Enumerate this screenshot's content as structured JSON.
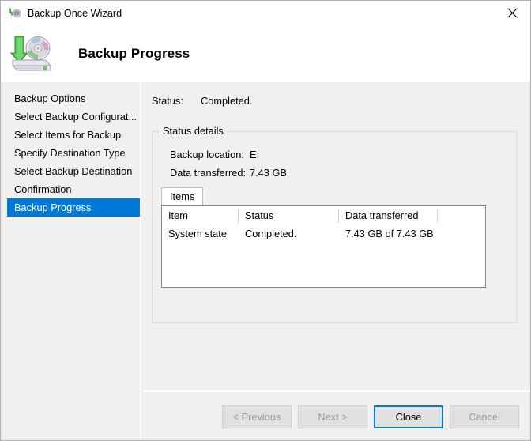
{
  "window": {
    "title": "Backup Once Wizard",
    "title_icon": "backup-disc-icon",
    "close_icon": "close-icon"
  },
  "header": {
    "title": "Backup Progress",
    "icon": "backup-drive-disc-icon"
  },
  "sidebar": {
    "items": [
      {
        "label": "Backup Options",
        "selected": false
      },
      {
        "label": "Select Backup Configurat...",
        "selected": false
      },
      {
        "label": "Select Items for Backup",
        "selected": false
      },
      {
        "label": "Specify Destination Type",
        "selected": false
      },
      {
        "label": "Select Backup Destination",
        "selected": false
      },
      {
        "label": "Confirmation",
        "selected": false
      },
      {
        "label": "Backup Progress",
        "selected": true
      }
    ],
    "selected_bg": "#0078d7"
  },
  "content": {
    "status_label": "Status:",
    "status_value": "Completed.",
    "groupbox_label": "Status details",
    "backup_location_label": "Backup location:",
    "backup_location_value": "E:",
    "data_transferred_label": "Data transferred:",
    "data_transferred_value": "7.43 GB",
    "tab_label": "Items",
    "table": {
      "columns": [
        "Item",
        "Status",
        "Data transferred"
      ],
      "rows": [
        [
          "System state",
          "Completed.",
          "7.43 GB of 7.43 GB"
        ]
      ]
    }
  },
  "footer": {
    "buttons": [
      {
        "label": "< Previous",
        "enabled": false,
        "default": false
      },
      {
        "label": "Next >",
        "enabled": false,
        "default": false
      },
      {
        "label": "Close",
        "enabled": true,
        "default": true
      },
      {
        "label": "Cancel",
        "enabled": false,
        "default": false
      }
    ],
    "focus_color": "#0078d7"
  }
}
